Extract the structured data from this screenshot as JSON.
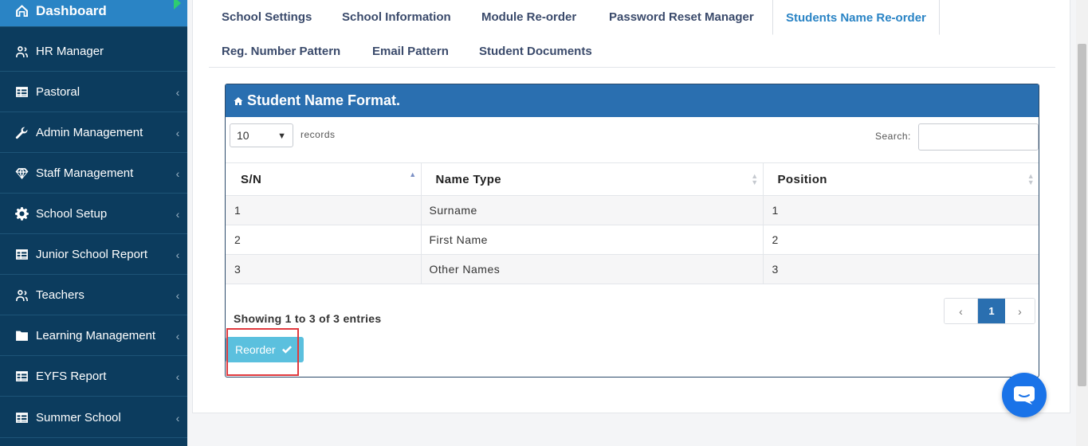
{
  "sidebar": {
    "items": [
      {
        "label": "Dashboard",
        "icon": "home-icon",
        "active": true
      },
      {
        "label": "HR Manager",
        "icon": "user-group-icon"
      },
      {
        "label": "Pastoral",
        "icon": "table-icon"
      },
      {
        "label": "Admin Management",
        "icon": "wrench-icon"
      },
      {
        "label": "Staff Management",
        "icon": "diamond-icon"
      },
      {
        "label": "School Setup",
        "icon": "gear-icon"
      },
      {
        "label": "Junior School Report",
        "icon": "table-icon"
      },
      {
        "label": "Teachers",
        "icon": "user-group-icon"
      },
      {
        "label": "Learning Management",
        "icon": "folder-icon"
      },
      {
        "label": "EYFS Report",
        "icon": "table-icon"
      },
      {
        "label": "Summer School",
        "icon": "table-icon"
      }
    ]
  },
  "tabs": [
    "School Settings",
    "School Information",
    "Module Re-order",
    "Password Reset Manager",
    "Students Name Re-order",
    "Reg. Number Pattern",
    "Email Pattern",
    "Student Documents"
  ],
  "active_tab": "Students Name Re-order",
  "card": {
    "title": "Student Name Format.",
    "length_value": "10",
    "records_label": "records",
    "search_label": "Search:",
    "search_value": "",
    "columns": [
      "S/N",
      "Name Type",
      "Position"
    ],
    "rows": [
      [
        "1",
        "Surname",
        "1"
      ],
      [
        "2",
        "First Name",
        "2"
      ],
      [
        "3",
        "Other Names",
        "3"
      ]
    ],
    "info": "Showing 1 to 3 of 3 entries",
    "pager": {
      "prev": "‹",
      "current": "1",
      "next": "›"
    },
    "reorder_label": "Reorder"
  },
  "colors": {
    "sidebar": "#0c3c5e",
    "active": "#2a84c5",
    "card_header": "#2a6fb0",
    "button": "#5bc0de",
    "highlight": "#e0393e"
  }
}
